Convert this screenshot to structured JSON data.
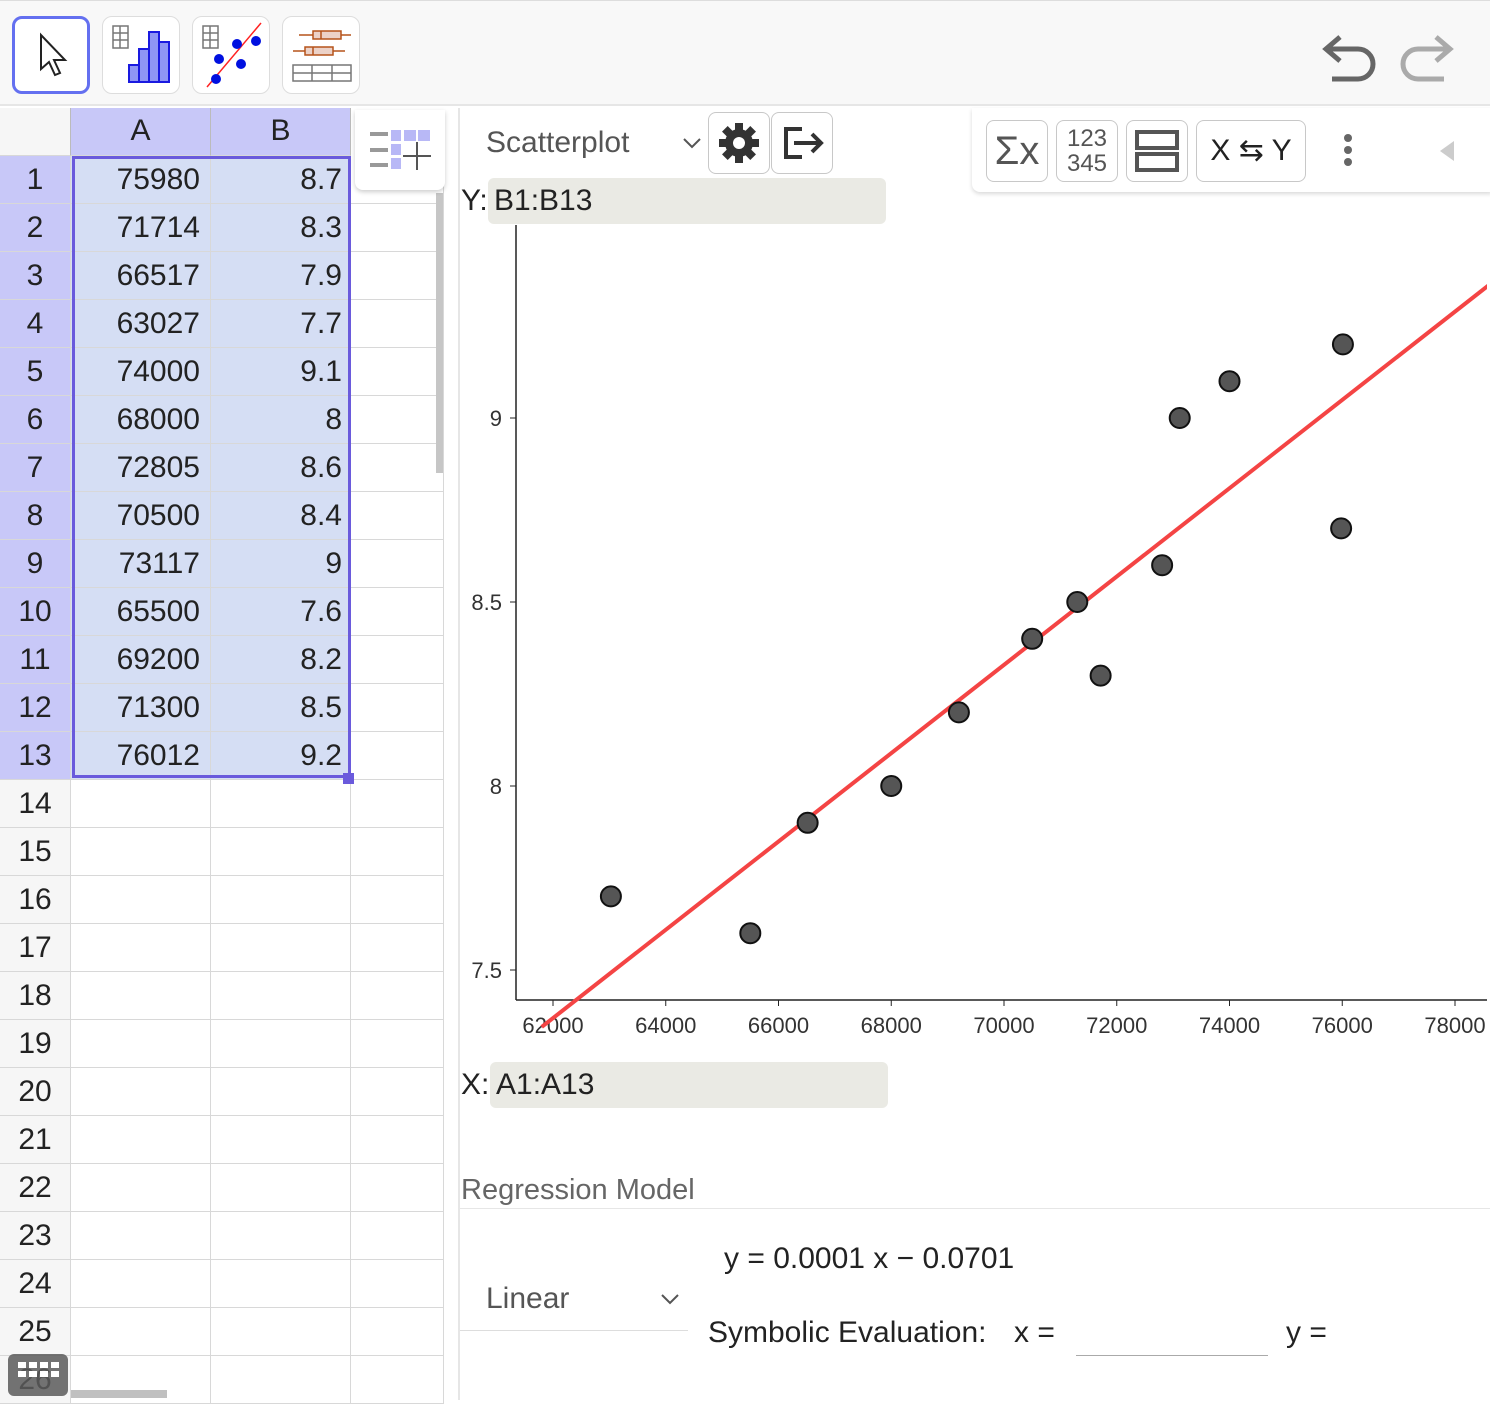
{
  "toolbar": {
    "tools": [
      {
        "name": "move",
        "selected": true
      },
      {
        "name": "one-variable-analysis"
      },
      {
        "name": "two-variable-regression"
      },
      {
        "name": "multi-variable-analysis"
      }
    ],
    "undo": "undo-icon",
    "redo": "redo-icon"
  },
  "sheet": {
    "columns": [
      "A",
      "B"
    ],
    "rows": [
      [
        "75980",
        "8.7"
      ],
      [
        "71714",
        "8.3"
      ],
      [
        "66517",
        "7.9"
      ],
      [
        "63027",
        "7.7"
      ],
      [
        "74000",
        "9.1"
      ],
      [
        "68000",
        "8"
      ],
      [
        "72805",
        "8.6"
      ],
      [
        "70500",
        "8.4"
      ],
      [
        "73117",
        "9"
      ],
      [
        "65500",
        "7.6"
      ],
      [
        "69200",
        "8.2"
      ],
      [
        "71300",
        "8.5"
      ],
      [
        "76012",
        "9.2"
      ]
    ],
    "empty_rows": [
      "14",
      "15",
      "16",
      "17",
      "18",
      "19",
      "20",
      "21",
      "22",
      "23",
      "24",
      "25",
      "26"
    ],
    "selection": "A1:B13",
    "accent": "#6a5adc"
  },
  "analysis": {
    "plot_type": "Scatterplot",
    "y_source_label": "Y:",
    "y_source": "B1:B13",
    "x_source_label": "X:",
    "x_source": "A1:A13",
    "buttons": {
      "stats": "Σx",
      "data": "123\n345",
      "swap": "X ⇆ Y"
    },
    "regression_title": "Regression Model",
    "model": "Linear",
    "equation": "y = 0.0001 x − 0.0701",
    "symbolic_label": "Symbolic Evaluation:",
    "x_eq": "x =",
    "y_eq": "y ="
  },
  "chart_data": {
    "type": "scatter",
    "x_ticks": [
      62000,
      64000,
      66000,
      68000,
      70000,
      72000,
      74000,
      76000,
      78000
    ],
    "y_ticks": [
      7.5,
      8,
      8.5,
      9
    ],
    "x_tick_labels": [
      "62000",
      "64000",
      "66000",
      "68000",
      "70000",
      "72000",
      "74000",
      "76000",
      "78000"
    ],
    "y_tick_labels": [
      "7.5",
      "8",
      "8.5",
      "9"
    ],
    "xlim": [
      61350,
      78600
    ],
    "ylim": [
      7.42,
      9.5
    ],
    "point_color": "#555555",
    "line_color": "#f44444",
    "regression": "linear",
    "grid": false
  }
}
